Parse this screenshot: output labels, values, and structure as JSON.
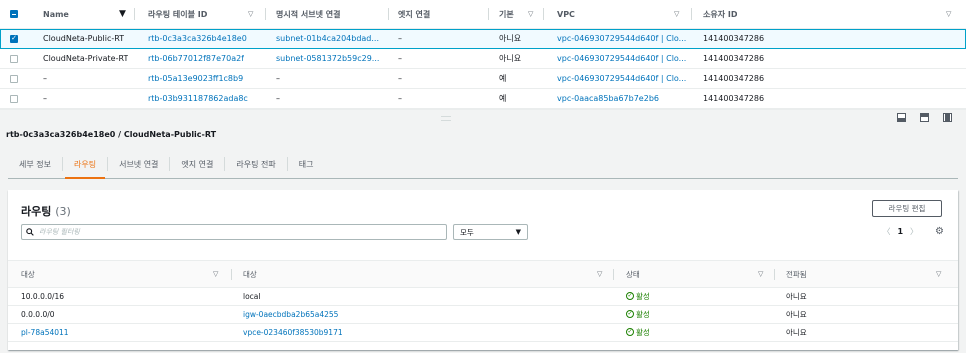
{
  "top_table": {
    "columns": [
      "Name",
      "라우팅 테이블 ID",
      "명시적 서브넷 연결",
      "엣지 연결",
      "기본",
      "VPC",
      "소유자 ID"
    ],
    "rows": [
      {
        "name": "CloudNeta-Public-RT",
        "rtb_id": "rtb-0c3a3ca326b4e18e0",
        "subnet": "subnet-01b4ca204bdad...",
        "edge": "–",
        "main": "아니요",
        "vpc": "vpc-046930729544d640f | Clo...",
        "owner": "141400347286",
        "selected": true
      },
      {
        "name": "CloudNeta-Private-RT",
        "rtb_id": "rtb-06b77012f87e70a2f",
        "subnet": "subnet-0581372b59c29...",
        "edge": "–",
        "main": "아니요",
        "vpc": "vpc-046930729544d640f | Clo...",
        "owner": "141400347286",
        "selected": false
      },
      {
        "name": "–",
        "rtb_id": "rtb-05a13e9023ff1c8b9",
        "subnet": "–",
        "edge": "–",
        "main": "예",
        "vpc": "vpc-046930729544d640f | Clo...",
        "owner": "141400347286",
        "selected": false
      },
      {
        "name": "–",
        "rtb_id": "rtb-03b931187862ada8c",
        "subnet": "–",
        "edge": "–",
        "main": "예",
        "vpc": "vpc-0aaca85ba67b7e2b6",
        "owner": "141400347286",
        "selected": false
      }
    ]
  },
  "detail": {
    "title": "rtb-0c3a3ca326b4e18e0 / CloudNeta-Public-RT",
    "tabs": [
      "세부 정보",
      "라우팅",
      "서브넷 연결",
      "엣지 연결",
      "라우팅 전파",
      "태그"
    ],
    "active_tab": 1
  },
  "routes": {
    "title": "라우팅",
    "count": "(3)",
    "edit_label": "라우팅 편집",
    "search_placeholder": "라우팅 필터링",
    "filter_value": "모두",
    "page": "1",
    "columns": [
      "대상",
      "대상",
      "상태",
      "전파됨"
    ],
    "rows": [
      {
        "destination": "10.0.0.0/16",
        "target": "local",
        "target_link": false,
        "dest_link": false,
        "status": "활성",
        "propagated": "아니요"
      },
      {
        "destination": "0.0.0.0/0",
        "target": "igw-0aecbdba2b65a4255",
        "target_link": true,
        "dest_link": false,
        "status": "활성",
        "propagated": "아니요"
      },
      {
        "destination": "pl-78a54011",
        "target": "vpce-023460f38530b9171",
        "target_link": true,
        "dest_link": true,
        "status": "활성",
        "propagated": "아니요"
      }
    ]
  },
  "colors": {
    "accent": "#ec7211",
    "link": "#0073bb",
    "success": "#1d8102",
    "selected_border": "#00a1c9"
  }
}
